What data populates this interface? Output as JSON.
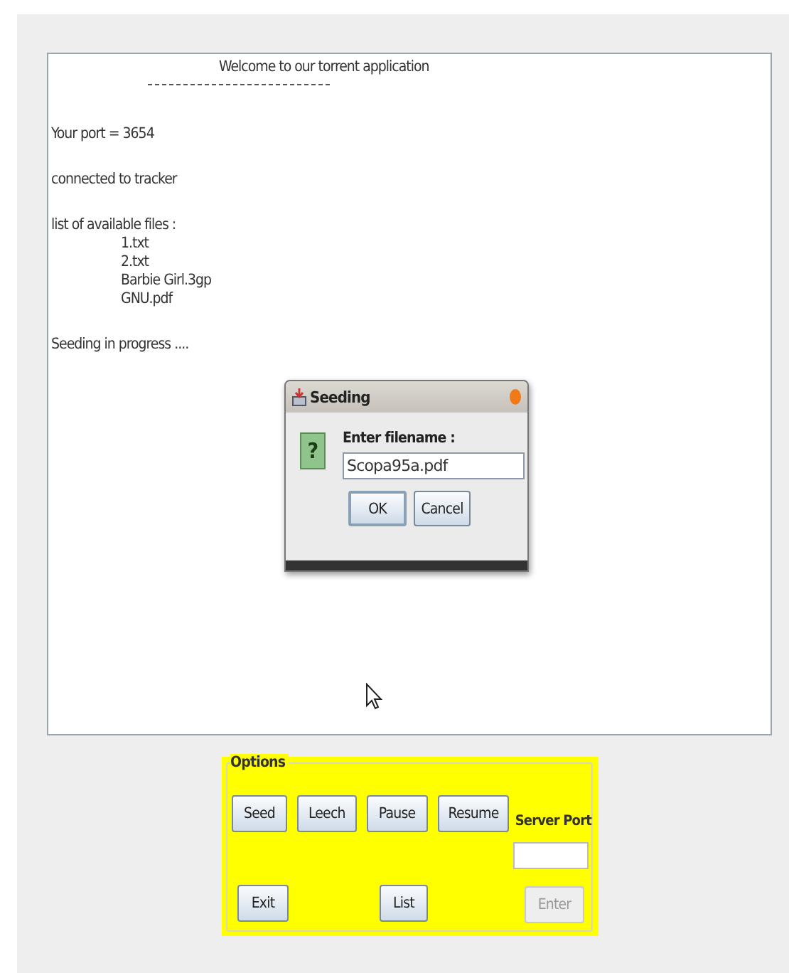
{
  "console": {
    "heading": "Welcome to our torrent application",
    "lines": [
      {
        "kind": "text",
        "text": "Your port = 3654"
      },
      {
        "kind": "text",
        "text": "connected to tracker"
      },
      {
        "kind": "text",
        "text": "list of available files :"
      },
      {
        "kind": "file",
        "text": "1.txt"
      },
      {
        "kind": "file",
        "text": "2.txt"
      },
      {
        "kind": "file",
        "text": "Barbie Girl.3gp"
      },
      {
        "kind": "file",
        "text": "GNU.pdf"
      },
      {
        "kind": "text",
        "text": "Seeding in progress ...."
      }
    ]
  },
  "dialog": {
    "title": "Seeding",
    "icon_glyph": "?",
    "prompt": "Enter filename :",
    "value": "Scopa95a.pdf",
    "buttons": [
      {
        "label": "OK",
        "selected": true
      },
      {
        "label": "Cancel",
        "selected": false
      }
    ]
  },
  "options": {
    "title": "Options",
    "top_buttons": [
      {
        "label": "Seed",
        "disabled": false
      },
      {
        "label": "Leech",
        "disabled": false
      },
      {
        "label": "Pause",
        "disabled": false
      },
      {
        "label": "Resume",
        "disabled": false
      }
    ],
    "server_port_label": "Server Port",
    "bottom_buttons": [
      {
        "label": "Exit",
        "disabled": false
      },
      {
        "label": "List",
        "disabled": false
      }
    ],
    "enter_button": {
      "label": "Enter",
      "disabled": true
    }
  }
}
